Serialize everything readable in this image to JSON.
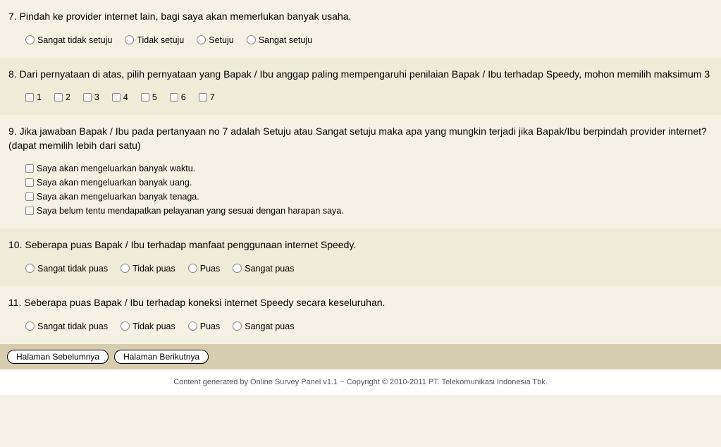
{
  "questions": {
    "q7": {
      "text": "7. Pindah ke provider internet lain, bagi saya akan memerlukan banyak usaha.",
      "options": [
        "Sangat tidak setuju",
        "Tidak setuju",
        "Setuju",
        "Sangat setuju"
      ]
    },
    "q8": {
      "text": "8. Dari pernyataan di atas, pilih pernyataan yang Bapak / Ibu anggap paling mempengaruhi penilaian Bapak / Ibu terhadap Speedy, mohon memilih maksimum 3",
      "options": [
        "1",
        "2",
        "3",
        "4",
        "5",
        "6",
        "7"
      ]
    },
    "q9": {
      "text": "9. Jika jawaban Bapak / Ibu pada pertanyaan no 7 adalah Setuju atau Sangat setuju maka apa yang mungkin terjadi jika Bapak/Ibu berpindah provider internet? (dapat memilih lebih dari satu)",
      "options": [
        "Saya akan mengeluarkan banyak waktu.",
        "Saya akan mengeluarkan banyak uang.",
        "Saya akan mengeluarkan banyak tenaga.",
        "Saya belum tentu mendapatkan pelayanan yang sesuai dengan harapan saya."
      ]
    },
    "q10": {
      "text": "10. Seberapa puas Bapak / Ibu terhadap manfaat penggunaan internet Speedy.",
      "options": [
        "Sangat tidak puas",
        "Tidak puas",
        "Puas",
        "Sangat puas"
      ]
    },
    "q11": {
      "text": "11. Seberapa puas Bapak / Ibu terhadap koneksi internet Speedy secara keseluruhan.",
      "options": [
        "Sangat tidak puas",
        "Tidak puas",
        "Puas",
        "Sangat puas"
      ]
    }
  },
  "nav": {
    "prev_label": "Halaman Sebelumnya",
    "next_label": "Halaman Berikutnya"
  },
  "footer": {
    "text": "Content generated by Online Survey Panel v1.1 ~ Copyright © 2010-2011 PT. Telekomunikasi Indonesia Tbk."
  }
}
